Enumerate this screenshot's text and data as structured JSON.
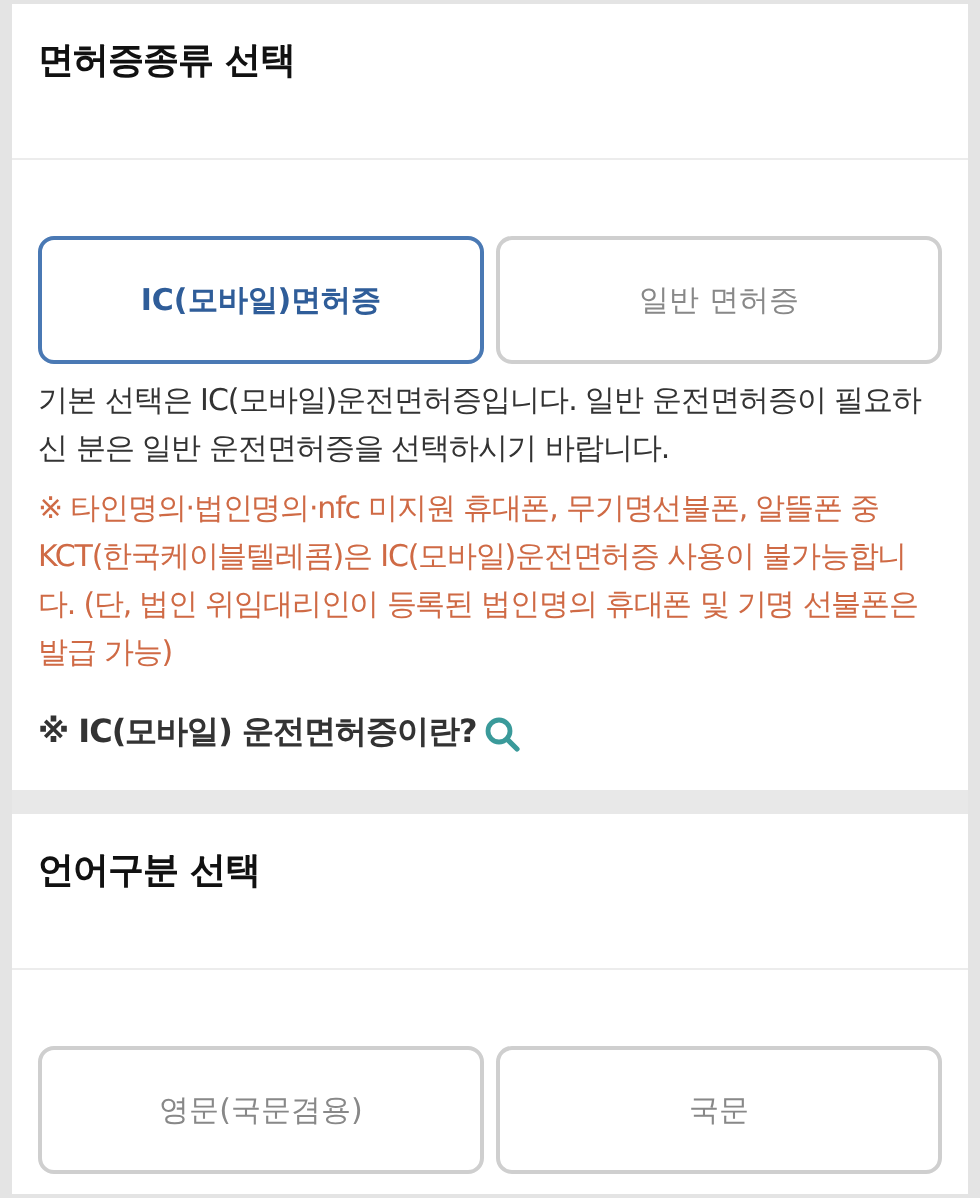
{
  "sections": [
    {
      "title": "면허증종류 선택",
      "options": [
        {
          "label": "IC(모바일)면허증",
          "selected": true
        },
        {
          "label": "일반 면허증",
          "selected": false
        }
      ],
      "description": "기본 선택은 IC(모바일)운전면허증입니다. 일반 운전면허증이 필요하신 분은 일반 운전면허증을 선택하시기 바랍니다.",
      "warning": "※ 타인명의·법인명의·nfc 미지원 휴대폰, 무기명선불폰, 알뜰폰 중 KCT(한국케이블텔레콤)은 IC(모바일)운전면허증 사용이 불가능합니다. (단, 법인 위임대리인이 등록된 법인명의 휴대폰 및 기명 선불폰은 발급 가능)",
      "info_link": "※ IC(모바일) 운전면허증이란?"
    },
    {
      "title": "언어구분 선택",
      "options": [
        {
          "label": "영문(국문겸용)",
          "selected": false
        },
        {
          "label": "국문",
          "selected": false
        }
      ]
    }
  ]
}
